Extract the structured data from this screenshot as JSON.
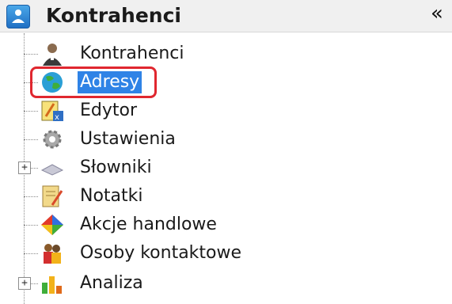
{
  "header": {
    "title": "Kontrahenci",
    "collapse_glyph": "«",
    "icon": "app-icon"
  },
  "tree": {
    "items": [
      {
        "label": "Kontrahenci",
        "icon": "person-icon",
        "expandable": false,
        "selected": false
      },
      {
        "label": "Adresy",
        "icon": "globe-icon",
        "expandable": false,
        "selected": true
      },
      {
        "label": "Edytor",
        "icon": "editor-icon",
        "expandable": false,
        "selected": false
      },
      {
        "label": "Ustawienia",
        "icon": "gear-icon",
        "expandable": false,
        "selected": false
      },
      {
        "label": "Słowniki",
        "icon": "dictionary-icon",
        "expandable": true,
        "selected": false
      },
      {
        "label": "Notatki",
        "icon": "notes-icon",
        "expandable": false,
        "selected": false
      },
      {
        "label": "Akcje handlowe",
        "icon": "sales-actions-icon",
        "expandable": false,
        "selected": false
      },
      {
        "label": "Osoby kontaktowe",
        "icon": "contacts-icon",
        "expandable": false,
        "selected": false
      },
      {
        "label": "Analiza",
        "icon": "analysis-icon",
        "expandable": true,
        "selected": false
      }
    ],
    "expand_glyph": "+"
  },
  "colors": {
    "selection": "#2f83e6",
    "highlight_ring": "#e0272f",
    "header_bg": "#f0f0f0"
  }
}
